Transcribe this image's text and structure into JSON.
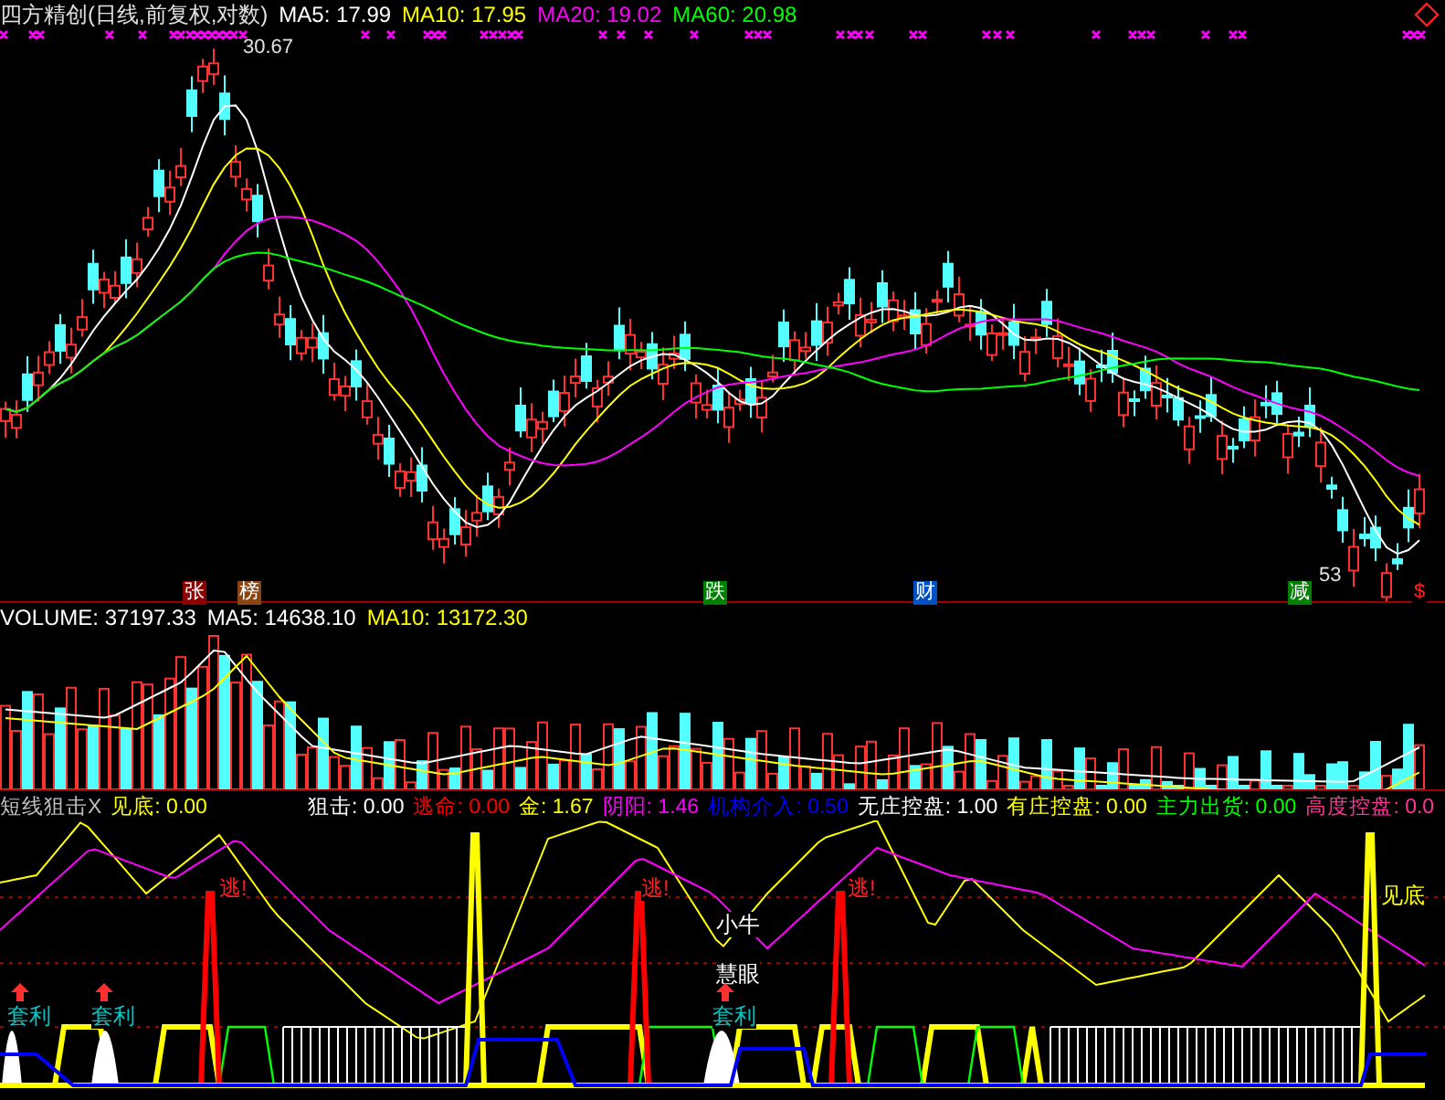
{
  "header": {
    "title": "四方精创(日线,前复权,对数)",
    "indicators": [
      {
        "label": "MA5: 17.99",
        "color": "#ffffff"
      },
      {
        "label": "MA10: 17.95",
        "color": "#ffff00"
      },
      {
        "label": "MA20: 19.02",
        "color": "#ff00ff"
      },
      {
        "label": "MA60: 20.98",
        "color": "#00ff00"
      }
    ]
  },
  "price_pane": {
    "high_label": "30.67",
    "low_label": "53",
    "markers": [
      {
        "text": "张",
        "color": "#8b0000"
      },
      {
        "text": "榜",
        "color": "#8b4513"
      },
      {
        "text": "跌",
        "color": "#008000"
      },
      {
        "text": "财",
        "color": "#0050c8"
      },
      {
        "text": "减",
        "color": "#008000"
      },
      {
        "text": "$",
        "color": "#000000"
      }
    ]
  },
  "volume_pane": {
    "indicators": [
      {
        "label": "VOLUME: 37197.33",
        "color": "#ffffff"
      },
      {
        "label": "MA5: 14638.10",
        "color": "#ffffff"
      },
      {
        "label": "MA10: 13172.30",
        "color": "#ffff00"
      }
    ]
  },
  "indicator_pane": {
    "indicators": [
      {
        "label": "短线狙击X",
        "color": "#c0c0c0"
      },
      {
        "label": "见底: 0.00",
        "color": "#ffff00"
      },
      {
        "label": "狙击: 0.00",
        "color": "#ffffff"
      },
      {
        "label": "逃命: 0.00",
        "color": "#ff0000"
      },
      {
        "label": "金: 1.67",
        "color": "#ffff00"
      },
      {
        "label": "阴阳: 1.46",
        "color": "#ff00ff"
      },
      {
        "label": "机构介入: 0.50",
        "color": "#0000ff"
      },
      {
        "label": "无庄控盘: 1.00",
        "color": "#ffffff"
      },
      {
        "label": "有庄控盘: 0.00",
        "color": "#ffff00"
      },
      {
        "label": "主力出货: 0.00",
        "color": "#00ff00"
      },
      {
        "label": "高度控盘: 0.0",
        "color": "#ff3399"
      }
    ],
    "signals": [
      {
        "text": "逃!",
        "kind": "escape"
      },
      {
        "text": "逃!",
        "kind": "escape"
      },
      {
        "text": "逃!",
        "kind": "escape"
      },
      {
        "text": "小牛",
        "kind": "note"
      },
      {
        "text": "慧眼",
        "kind": "note"
      },
      {
        "text": "套利",
        "kind": "arbitrage"
      },
      {
        "text": "套利",
        "kind": "arbitrage"
      },
      {
        "text": "套利",
        "kind": "arbitrage"
      },
      {
        "text": "见底",
        "kind": "bottom"
      }
    ]
  }
}
